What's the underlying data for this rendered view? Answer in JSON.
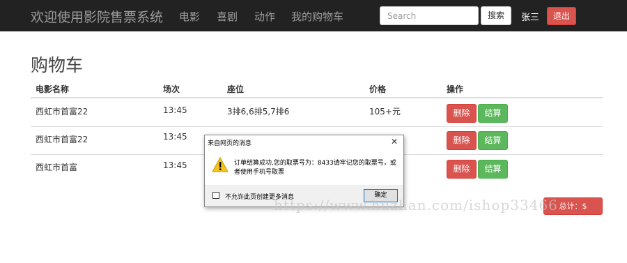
{
  "navbar": {
    "brand": "欢迎使用影院售票系统",
    "links": [
      "电影",
      "喜剧",
      "动作",
      "我的购物车"
    ],
    "search_placeholder": "Search",
    "search_button": "搜索",
    "username": "张三",
    "logout_button": "退出"
  },
  "page": {
    "title": "购物车"
  },
  "table": {
    "headers": [
      "电影名称",
      "场次",
      "座位",
      "价格",
      "操作"
    ],
    "rows": [
      {
        "name": "西虹市首富22",
        "time": "13:45",
        "seats": "3排6,6排5,7排6",
        "price": "105+元"
      },
      {
        "name": "西虹市首富22",
        "time": "13:45",
        "seats": "",
        "price": ""
      },
      {
        "name": "西虹市首富",
        "time": "13:45",
        "seats": "",
        "price": ""
      }
    ],
    "delete_label": "删除",
    "checkout_label": "结算"
  },
  "total_button": "总计：$",
  "dialog": {
    "title": "来自网页的消息",
    "close": "✕",
    "message": "订单结算成功,您的取票号为：8433请牢记您的取票号，或者使用手机号取票",
    "checkbox_label": "不允许此页创建更多消息",
    "ok_button": "确定",
    "icon": "warning-icon"
  },
  "watermark": "https://www.huzhan.com/ishop33466",
  "colors": {
    "navbar_bg": "#222222",
    "danger": "#d9534f",
    "success": "#5cb85c"
  }
}
